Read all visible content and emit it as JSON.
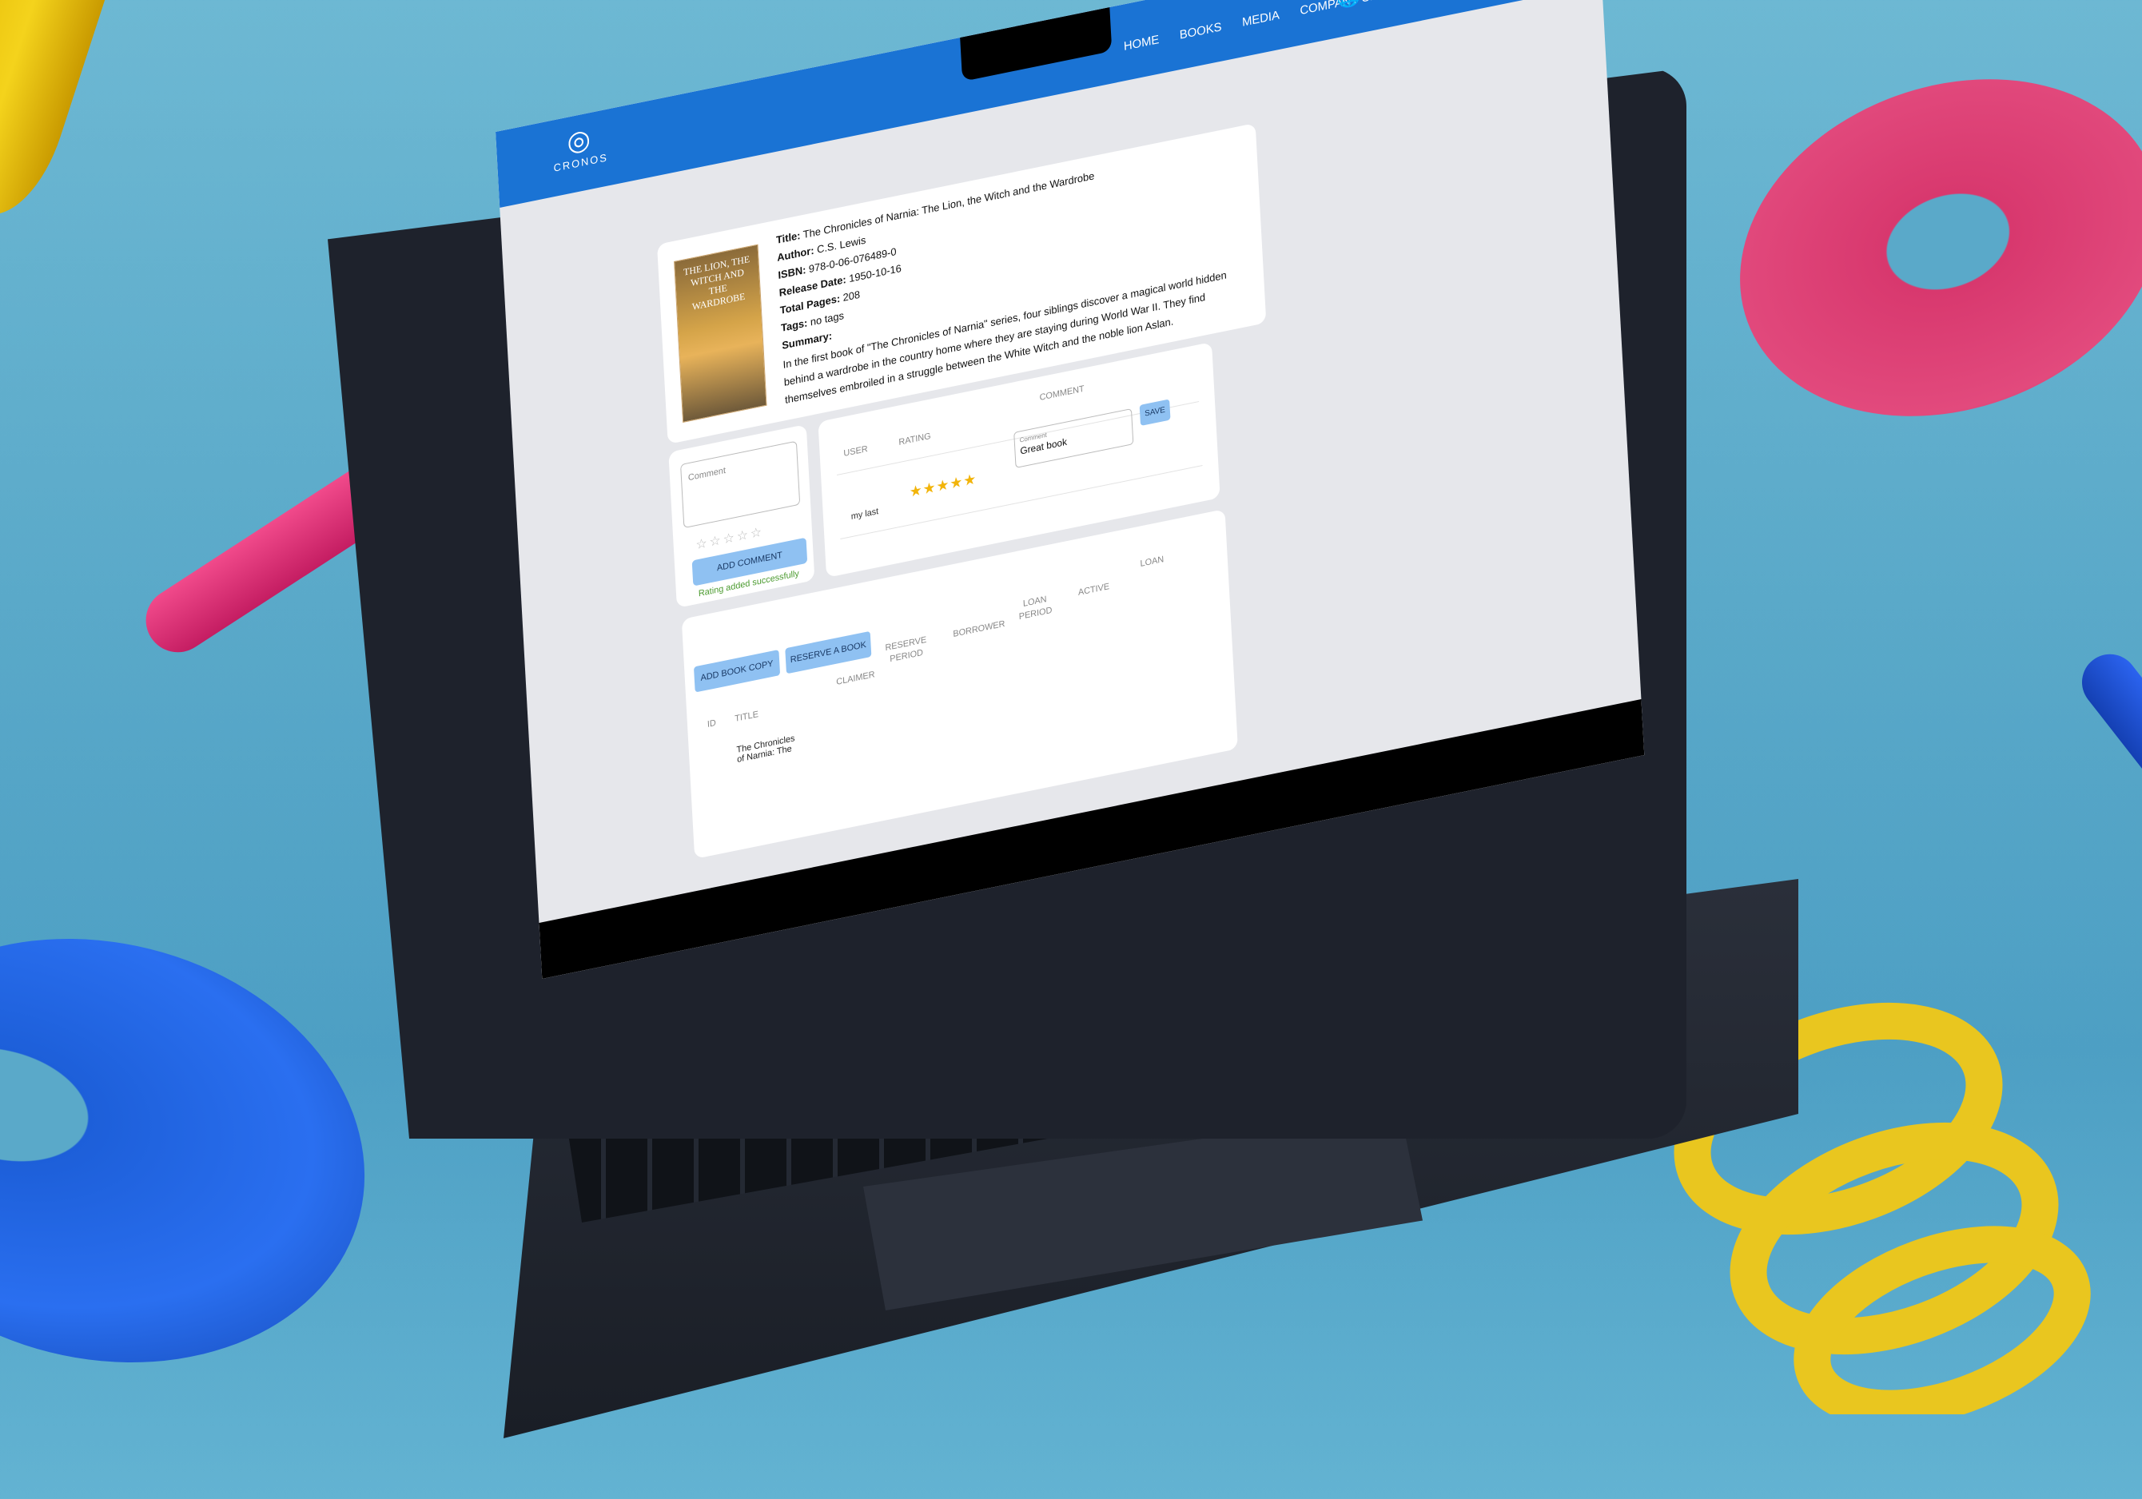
{
  "brand": {
    "name": "CRONOS",
    "primary_color": "#1a73d4"
  },
  "nav": {
    "items": [
      "HOME",
      "BOOKS",
      "MEDIA",
      "COMPANY SETTINGS"
    ]
  },
  "header_icons": [
    "globe-icon",
    "user-icon"
  ],
  "book": {
    "cover_text": "THE LION, THE WITCH AND THE WARDROBE",
    "title_label": "Title:",
    "title": "The Chronicles of Narnia: The Lion, the Witch and the Wardrobe",
    "author_label": "Author:",
    "author": "C.S. Lewis",
    "isbn_label": "ISBN:",
    "isbn": "978-0-06-076489-0",
    "release_label": "Release Date:",
    "release_date": "1950-10-16",
    "pages_label": "Total Pages:",
    "pages": "208",
    "tags_label": "Tags:",
    "tags": "no tags",
    "summary_label": "Summary:",
    "summary": "In the first book of \"The Chronicles of Narnia\" series, four siblings discover a magical world hidden behind a wardrobe in the country home where they are staying during World War II. They find themselves embroiled in a struggle between the White Witch and the noble lion Aslan."
  },
  "add_comment": {
    "placeholder": "Comment",
    "stars": "☆☆☆☆☆",
    "button": "ADD COMMENT",
    "success": "Rating added successfully"
  },
  "ratings": {
    "headers": {
      "user": "USER",
      "rating": "RATING",
      "comment": "COMMENT"
    },
    "rows": [
      {
        "user": "my last",
        "stars": "★★★★★",
        "rating": 5,
        "comment_label": "Comment",
        "comment": "Great book"
      }
    ],
    "save": "SAVE"
  },
  "copies": {
    "add_copy": "ADD BOOK COPY",
    "reserve": "RESERVE A BOOK",
    "headers": {
      "id": "ID",
      "title": "TITLE",
      "claimer": "CLAIMER",
      "reserve_period": "RESERVE PERIOD",
      "borrower": "BORROWER",
      "loan_period": "LOAN PERIOD",
      "active": "ACTIVE",
      "loan": "LOAN"
    },
    "rows": [
      {
        "title": "The Chronicles of Narnia: The"
      }
    ]
  }
}
